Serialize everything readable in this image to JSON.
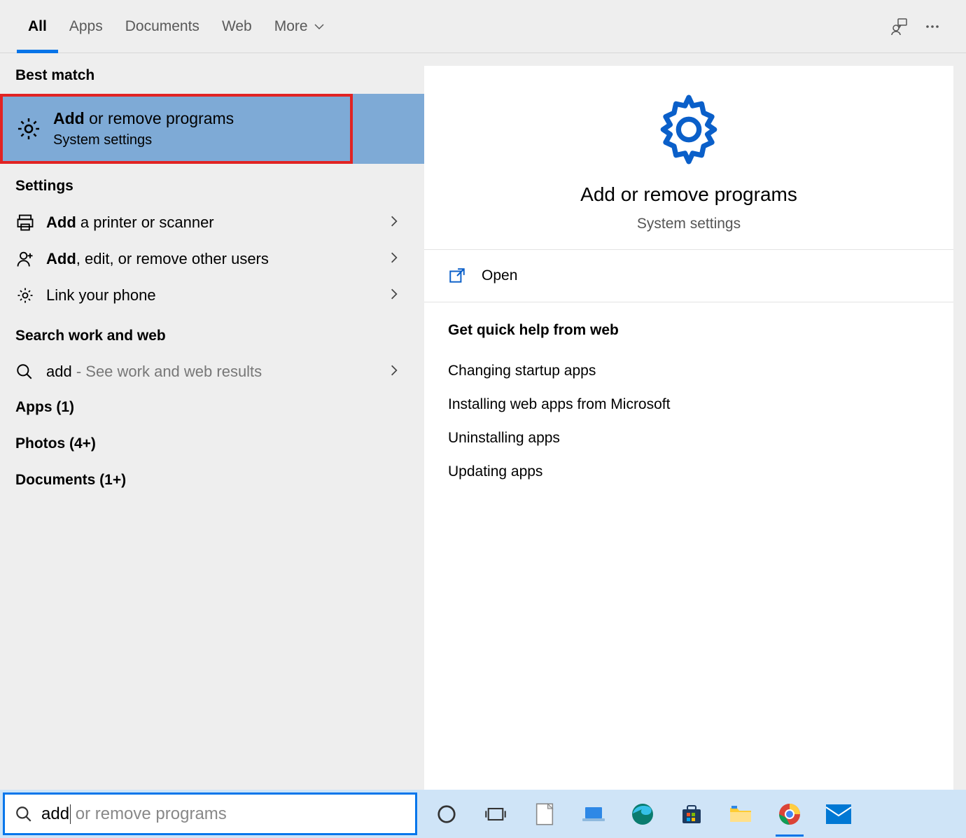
{
  "nav": {
    "tabs": [
      "All",
      "Apps",
      "Documents",
      "Web",
      "More"
    ],
    "active": 0
  },
  "left": {
    "best_match_label": "Best match",
    "best_match": {
      "title_bold": "Add",
      "title_rest": " or remove programs",
      "subtitle": "System settings"
    },
    "settings_label": "Settings",
    "settings_items": [
      {
        "icon": "printer",
        "bold": "Add",
        "rest": " a printer or scanner"
      },
      {
        "icon": "user-plus",
        "bold": "Add",
        "rest": ", edit, or remove other users"
      },
      {
        "icon": "gear",
        "bold": "",
        "rest": "Link your phone"
      }
    ],
    "search_label": "Search work and web",
    "search_item": {
      "bold": "add",
      "rest": " - See work and web results"
    },
    "apps_label": "Apps (1)",
    "photos_label": "Photos (4+)",
    "documents_label": "Documents (1+)"
  },
  "right": {
    "title": "Add or remove programs",
    "subtitle": "System settings",
    "open": "Open",
    "help_title": "Get quick help from web",
    "help_links": [
      "Changing startup apps",
      "Installing web apps from Microsoft",
      "Uninstalling apps",
      "Updating apps"
    ]
  },
  "search": {
    "value": "add",
    "placeholder": " or remove programs"
  },
  "colors": {
    "accent": "#0774e8",
    "highlight": "#7eaad6",
    "annotation": "#e12323"
  }
}
